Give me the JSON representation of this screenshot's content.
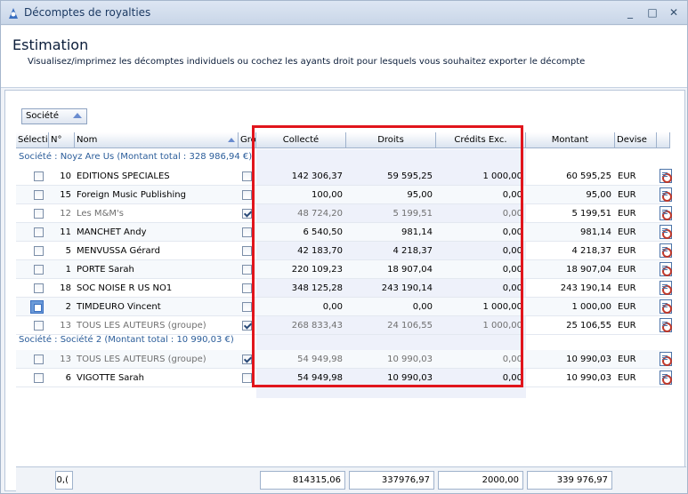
{
  "window": {
    "title": "Décomptes de royalties",
    "min_label": "_",
    "max_label": "□",
    "close_label": "✕"
  },
  "header": {
    "title": "Estimation",
    "subtitle": "Visualisez/imprimez les décomptes individuels ou cochez les ayants droit pour lesquels vous souhaitez exporter le décompte"
  },
  "group_by": {
    "label": "Société"
  },
  "columns": {
    "select": "Sélecti",
    "number": "N°",
    "name": "Nom",
    "group": "Gro",
    "collected": "Collecté",
    "rights": "Droits",
    "credits": "Crédits Exc.",
    "amount": "Montant",
    "currency": "Devise"
  },
  "groups": [
    {
      "label": "Société : Noyz Are Us (Montant total : 328 986,94 €)"
    },
    {
      "label": "Société : Société 2 (Montant total : 10 990,03 €)"
    }
  ],
  "rows": [
    {
      "num": "10",
      "name": "EDITIONS SPECIALES",
      "group_checked": false,
      "collected": "142 306,37",
      "rights": "59 595,25",
      "credits": "1 000,00",
      "amount": "60 595,25",
      "currency": "EUR",
      "dim": false
    },
    {
      "num": "15",
      "name": "Foreign Music Publishing",
      "group_checked": false,
      "collected": "100,00",
      "rights": "95,00",
      "credits": "0,00",
      "amount": "95,00",
      "currency": "EUR",
      "dim": false
    },
    {
      "num": "12",
      "name": "Les M&M's",
      "group_checked": true,
      "collected": "48 724,20",
      "rights": "5 199,51",
      "credits": "0,00",
      "amount": "5 199,51",
      "currency": "EUR",
      "dim": true
    },
    {
      "num": "11",
      "name": "MANCHET Andy",
      "group_checked": false,
      "collected": "6 540,50",
      "rights": "981,14",
      "credits": "0,00",
      "amount": "981,14",
      "currency": "EUR",
      "dim": false
    },
    {
      "num": "5",
      "name": "MENVUSSA Gérard",
      "group_checked": false,
      "collected": "42 183,70",
      "rights": "4 218,37",
      "credits": "0,00",
      "amount": "4 218,37",
      "currency": "EUR",
      "dim": false
    },
    {
      "num": "1",
      "name": "PORTE Sarah",
      "group_checked": false,
      "collected": "220 109,23",
      "rights": "18 907,04",
      "credits": "0,00",
      "amount": "18 907,04",
      "currency": "EUR",
      "dim": false
    },
    {
      "num": "18",
      "name": "SOC NOISE R US NO1",
      "group_checked": false,
      "collected": "348 125,28",
      "rights": "243 190,14",
      "credits": "0,00",
      "amount": "243 190,14",
      "currency": "EUR",
      "dim": false
    },
    {
      "num": "2",
      "name": "TIMDEURO Vincent",
      "group_checked": false,
      "collected": "0,00",
      "rights": "0,00",
      "credits": "1 000,00",
      "amount": "1 000,00",
      "currency": "EUR",
      "dim": false
    },
    {
      "num": "13",
      "name": "TOUS LES AUTEURS (groupe)",
      "group_checked": true,
      "collected": "268 833,43",
      "rights": "24 106,55",
      "credits": "1 000,00",
      "amount": "25 106,55",
      "currency": "EUR",
      "dim": true
    },
    {
      "num": "13",
      "name": "TOUS LES AUTEURS (groupe)",
      "group_checked": true,
      "collected": "54 949,98",
      "rights": "10 990,03",
      "credits": "0,00",
      "amount": "10 990,03",
      "currency": "EUR",
      "dim": true
    },
    {
      "num": "6",
      "name": "VIGOTTE Sarah",
      "group_checked": false,
      "collected": "54 949,98",
      "rights": "10 990,03",
      "credits": "0,00",
      "amount": "10 990,03",
      "currency": "EUR",
      "dim": false
    }
  ],
  "footer": {
    "select_total": "0,(",
    "collected_total": "814315,06",
    "rights_total": "337976,97",
    "credits_total": "2000,00",
    "amount_total": "339 976,97"
  }
}
